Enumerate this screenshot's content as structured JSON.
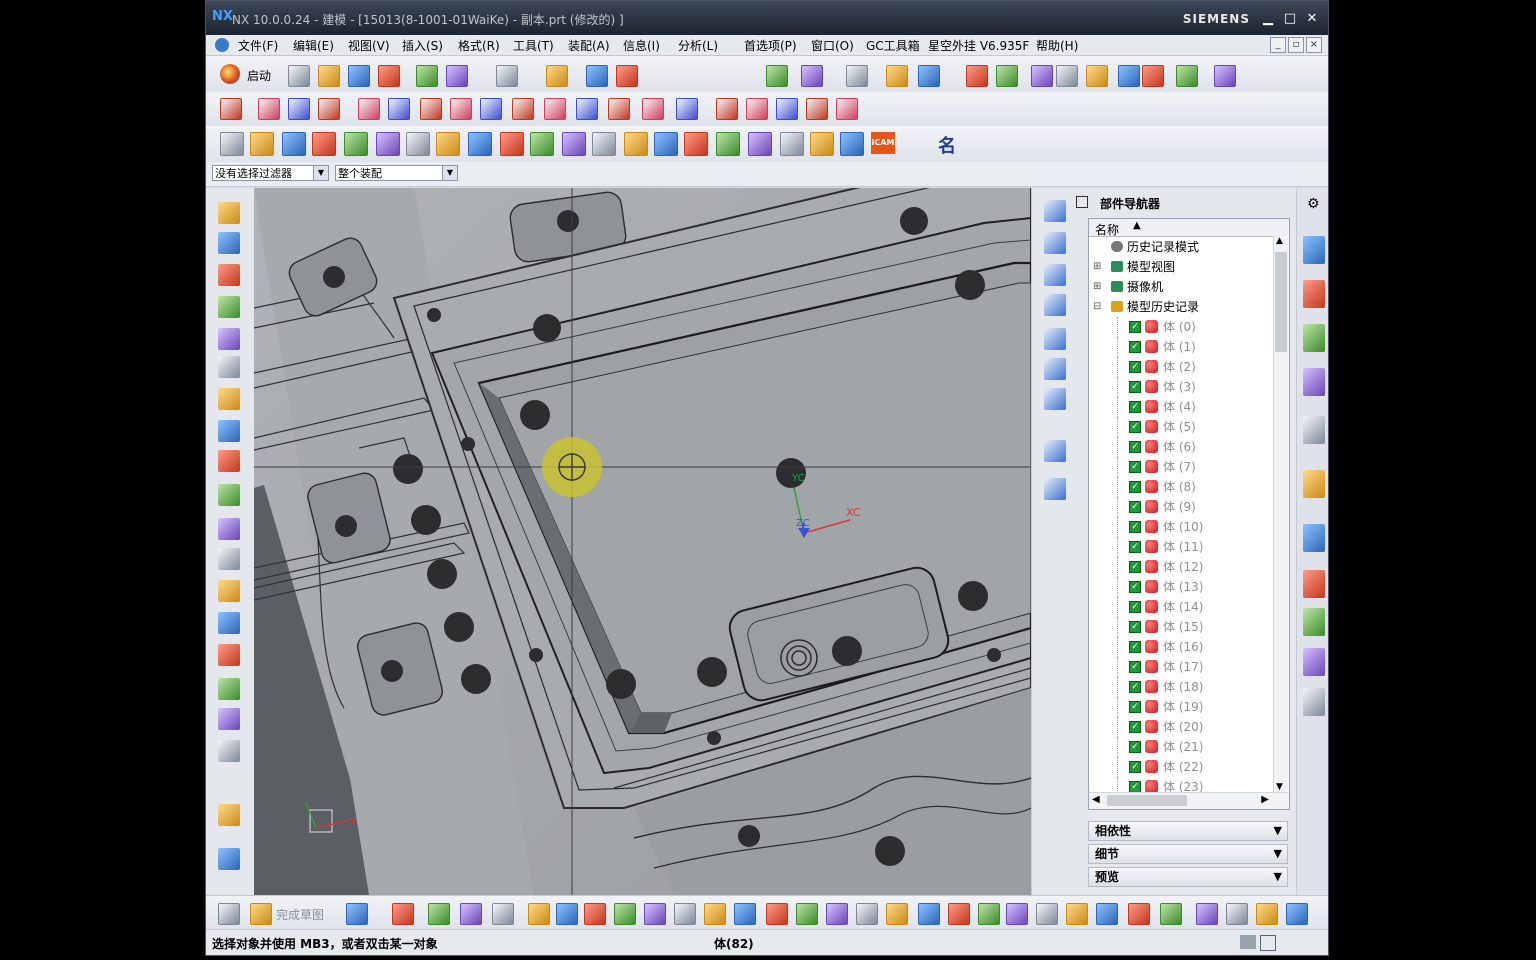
{
  "window": {
    "title": "NX 10.0.0.24 - 建模 - [15013(8-1001-01WaiKe) - 副本.prt  (修改的) ]",
    "brand": "SIEMENS",
    "logo": "NX",
    "minimize": "▁",
    "maximize": "□",
    "close": "✕"
  },
  "menu": {
    "items": [
      "文件(F)",
      "编辑(E)",
      "视图(V)",
      "插入(S)",
      "格式(R)",
      "工具(T)",
      "装配(A)",
      "信息(I)",
      "分析(L)",
      "首选项(P)",
      "窗口(O)",
      "GC工具箱",
      "星空外挂 V6.935F",
      "帮助(H)"
    ]
  },
  "toolbar": {
    "start_label": "启动",
    "filter_combo": "没有选择过滤器",
    "assembly_combo": "整个装配",
    "icam_label": "iCAM",
    "name_label": "名"
  },
  "viewport": {
    "triad": {
      "yc": "YC",
      "xc": "XC",
      "zc": "ZC"
    },
    "corner_x": "X"
  },
  "navigator": {
    "title": "部件导航器",
    "column_name": "名称",
    "top_nodes": [
      "历史记录模式",
      "模型视图",
      "摄像机",
      "模型历史记录"
    ],
    "bodies": [
      "体 (0)",
      "体 (1)",
      "体 (2)",
      "体 (3)",
      "体 (4)",
      "体 (5)",
      "体 (6)",
      "体 (7)",
      "体 (8)",
      "体 (9)",
      "体 (10)",
      "体 (11)",
      "体 (12)",
      "体 (13)",
      "体 (14)",
      "体 (15)",
      "体 (16)",
      "体 (17)",
      "体 (18)",
      "体 (19)",
      "体 (20)",
      "体 (21)",
      "体 (22)",
      "体 (23)"
    ],
    "sections": [
      "相依性",
      "细节",
      "预览"
    ]
  },
  "bottom_toolbar": {
    "finish_sketch": "完成草图"
  },
  "status": {
    "prompt": "选择对象并使用 MB3，或者双击某一对象",
    "selection": "体(82)"
  },
  "colors": {
    "accent": "#3ea0ff",
    "check": "#1e9a38",
    "titlebar": "#1e2531",
    "highlight": "#c8c231"
  }
}
